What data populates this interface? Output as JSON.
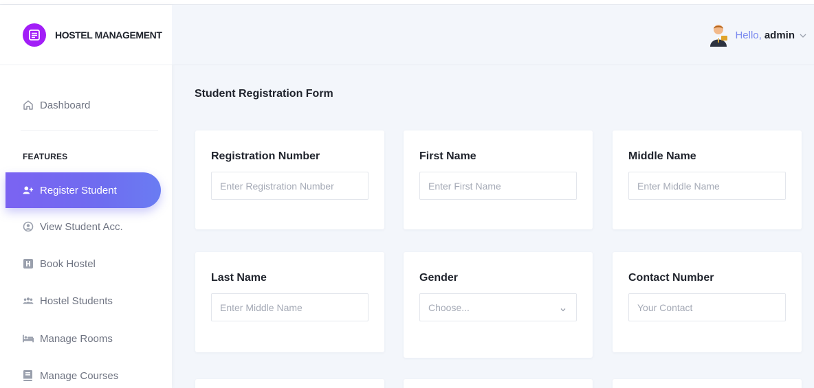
{
  "brand": {
    "name": "HOSTEL MANAGEMENT"
  },
  "header": {
    "greeting": "Hello,",
    "username": "admin"
  },
  "sidebar": {
    "dashboard": {
      "label": "Dashboard",
      "icon": "home-icon"
    },
    "section_label": "FEATURES",
    "items": [
      {
        "label": "Register Student",
        "icon": "user-plus-icon",
        "active": true
      },
      {
        "label": "View Student Acc.",
        "icon": "user-circle-icon",
        "active": false
      },
      {
        "label": "Book Hostel",
        "icon": "hostel-icon",
        "active": false
      },
      {
        "label": "Hostel Students",
        "icon": "users-icon",
        "active": false
      },
      {
        "label": "Manage Rooms",
        "icon": "bed-icon",
        "active": false
      },
      {
        "label": "Manage Courses",
        "icon": "book-icon",
        "active": false
      }
    ]
  },
  "main": {
    "title": "Student Registration Form",
    "fields": [
      {
        "label": "Registration Number",
        "placeholder": "Enter Registration Number",
        "type": "input"
      },
      {
        "label": "First Name",
        "placeholder": "Enter First Name",
        "type": "input"
      },
      {
        "label": "Middle Name",
        "placeholder": "Enter Middle Name",
        "type": "input"
      },
      {
        "label": "Last Name",
        "placeholder": "Enter Middle Name",
        "type": "input"
      },
      {
        "label": "Gender",
        "placeholder": "Choose...",
        "type": "select"
      },
      {
        "label": "Contact Number",
        "placeholder": "Your Contact",
        "type": "input"
      }
    ]
  },
  "colors": {
    "accent": "#6f6cf0",
    "brand_logo": "#a21ef7",
    "greeting": "#7b8aef",
    "background": "#f3f6fb"
  }
}
